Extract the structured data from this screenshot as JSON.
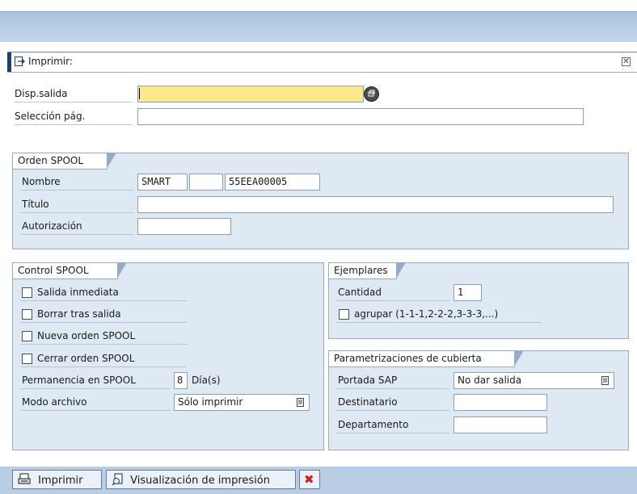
{
  "dialog": {
    "title": "Imprimir:"
  },
  "form": {
    "output_device_label": "Disp.salida",
    "output_device_value": "",
    "page_selection_label": "Selección pág.",
    "page_selection_value": ""
  },
  "spool_order": {
    "title": "Orden SPOOL",
    "name_label": "Nombre",
    "name_value1": "SMART",
    "name_value2": "",
    "name_value3": "55EEA00005",
    "title_label": "Título",
    "title_value": "",
    "auth_label": "Autorización",
    "auth_value": ""
  },
  "spool_control": {
    "title": "Control SPOOL",
    "immediate_output": {
      "label": "Salida inmediata",
      "checked": false
    },
    "delete_after_output": {
      "label": "Borrar tras salida",
      "checked": false
    },
    "new_spool_request": {
      "label": "Nueva orden SPOOL",
      "checked": false
    },
    "close_spool_request": {
      "label": "Cerrar orden SPOOL",
      "checked": false
    },
    "retention_label": "Permanencia en SPOOL",
    "retention_value": "8",
    "retention_unit": "Día(s)",
    "archive_mode_label": "Modo archivo",
    "archive_mode_value": "Sólo imprimir"
  },
  "copies": {
    "title": "Ejemplares",
    "quantity_label": "Cantidad",
    "quantity_value": "1",
    "group_label": "agrupar (1-1-1,2-2-2,3-3-3,...)",
    "group_checked": false
  },
  "cover": {
    "title": "Parametrizaciones de cubierta",
    "sap_cover_label": "Portada SAP",
    "sap_cover_value": "No dar salida",
    "recipient_label": "Destinatario",
    "recipient_value": "",
    "department_label": "Departamento",
    "department_value": ""
  },
  "buttons": {
    "print_label": "Imprimir",
    "preview_label": "Visualización de impresión"
  },
  "colors": {
    "accent": "#1d3f73",
    "group_bg": "#dfe9f4",
    "required_field": "#fde98c",
    "cancel_red": "#d41b1b"
  }
}
